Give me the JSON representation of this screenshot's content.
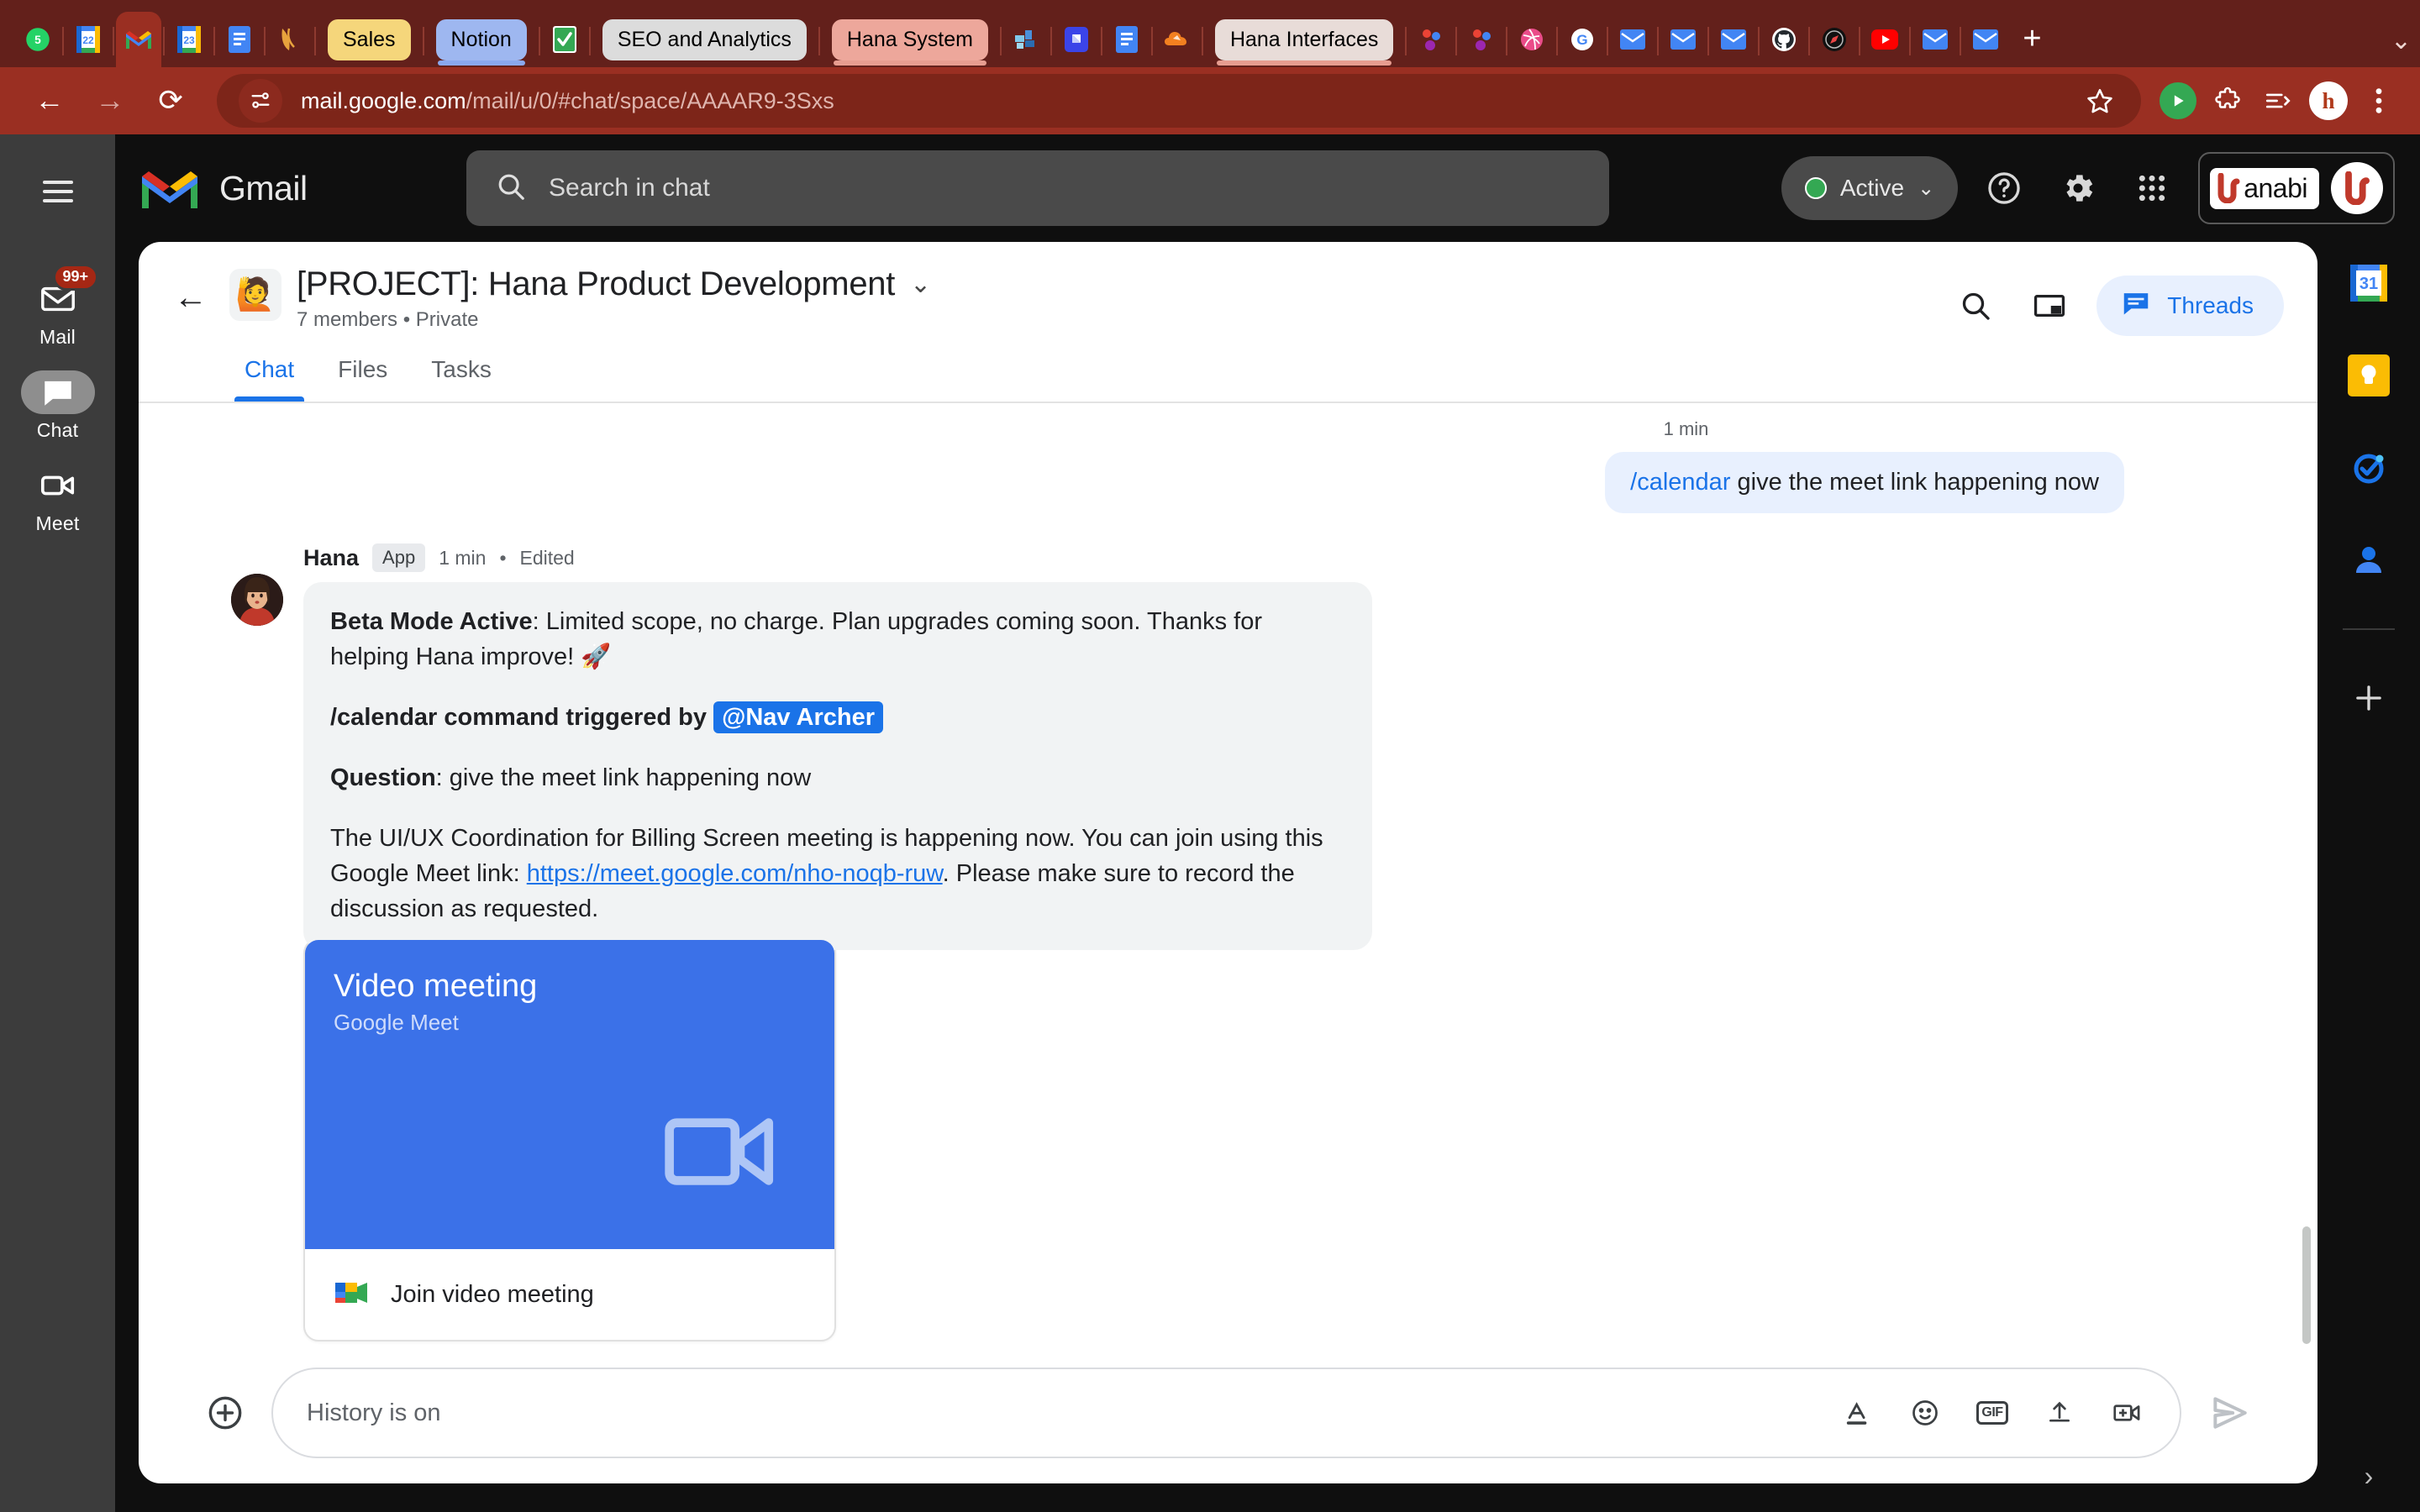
{
  "browser": {
    "tabs": [
      {
        "name": "whatsapp-tab",
        "label": "",
        "icon": "whatsapp-icon",
        "color": "#25D366",
        "text": "5",
        "style": "icon"
      },
      {
        "name": "calendar-22-tab",
        "label": "",
        "icon": "calendar-icon",
        "color": "#ffffff",
        "text": "22",
        "style": "icon"
      },
      {
        "name": "gmail-tab",
        "label": "",
        "icon": "gmail-icon",
        "color": "#ffffff",
        "text": "M",
        "style": "icon",
        "active": true
      },
      {
        "name": "calendar-23-tab",
        "label": "",
        "icon": "calendar-icon",
        "color": "#ffffff",
        "text": "23",
        "style": "icon"
      },
      {
        "name": "docs-tab",
        "label": "",
        "icon": "docs-icon",
        "color": "#4285f4",
        "text": "",
        "style": "icon"
      },
      {
        "name": "figma-tab",
        "label": "",
        "icon": "feather-icon",
        "color": "#e8a33d",
        "text": "",
        "style": "icon"
      },
      {
        "name": "sales-tab",
        "label": "Sales",
        "icon": "",
        "color": "#f5d67b",
        "text": "",
        "style": "pill"
      },
      {
        "name": "notion-tab",
        "label": "Notion",
        "icon": "",
        "color": "#9eb7f0",
        "text": "",
        "style": "pill",
        "underline": "#8aa8ee"
      },
      {
        "name": "tasks-tab",
        "label": "",
        "icon": "checkmark-icon",
        "color": "#34a853",
        "text": "✓",
        "style": "icon"
      },
      {
        "name": "seo-tab",
        "label": "SEO and Analytics",
        "icon": "",
        "color": "#dcdcdc",
        "text": "",
        "style": "pill"
      },
      {
        "name": "hana-system-tab",
        "label": "Hana System",
        "icon": "",
        "color": "#eda79b",
        "text": "",
        "style": "pill",
        "underline": "#e79d90"
      },
      {
        "name": "slack-tab",
        "label": "",
        "icon": "slack-icon",
        "color": "#4a90d9",
        "text": "",
        "style": "icon"
      },
      {
        "name": "zapier-tab",
        "label": "",
        "icon": "zapier-icon",
        "color": "#3b44e8",
        "text": "",
        "style": "icon"
      },
      {
        "name": "docs2-tab",
        "label": "",
        "icon": "docs-icon",
        "color": "#4285f4",
        "text": "",
        "style": "icon"
      },
      {
        "name": "cloud-tab",
        "label": "",
        "icon": "cloudflare-icon",
        "color": "#f38020",
        "text": "",
        "style": "icon"
      },
      {
        "name": "hana-interfaces-tab",
        "label": "Hana Interfaces",
        "icon": "",
        "color": "#e8dcd8",
        "text": "",
        "style": "pill",
        "underline": "#e79d90"
      },
      {
        "name": "people-tab",
        "label": "",
        "icon": "people-icon",
        "color": "#4285f4",
        "text": "",
        "style": "icon"
      },
      {
        "name": "people2-tab",
        "label": "",
        "icon": "people-icon",
        "color": "#db4437",
        "text": "",
        "style": "icon"
      },
      {
        "name": "dribbble-tab",
        "label": "",
        "icon": "dribbble-icon",
        "color": "#ea4c89",
        "text": "",
        "style": "icon"
      },
      {
        "name": "google-tab",
        "label": "",
        "icon": "google-icon",
        "color": "#4285f4",
        "text": "G",
        "style": "icon"
      },
      {
        "name": "mail2-tab",
        "label": "",
        "icon": "mail-icon",
        "color": "#4285f4",
        "text": "",
        "style": "icon"
      },
      {
        "name": "mail3-tab",
        "label": "",
        "icon": "mail-icon",
        "color": "#4285f4",
        "text": "",
        "style": "icon"
      },
      {
        "name": "mail4-tab",
        "label": "",
        "icon": "mail-icon",
        "color": "#4285f4",
        "text": "",
        "style": "icon"
      },
      {
        "name": "github-tab",
        "label": "",
        "icon": "github-icon",
        "color": "#ffffff",
        "text": "",
        "style": "icon"
      },
      {
        "name": "safari-tab",
        "label": "",
        "icon": "compass-icon",
        "color": "#111111",
        "text": "",
        "style": "icon"
      },
      {
        "name": "youtube-tab",
        "label": "",
        "icon": "youtube-icon",
        "color": "#ff0000",
        "text": "",
        "style": "icon"
      },
      {
        "name": "mail5-tab",
        "label": "",
        "icon": "mail-icon",
        "color": "#4285f4",
        "text": "",
        "style": "icon"
      },
      {
        "name": "mail6-tab",
        "label": "",
        "icon": "mail-icon",
        "color": "#4285f4",
        "text": "",
        "style": "icon"
      }
    ],
    "new_tab_label": "+",
    "tab_list_chevron": "⌄",
    "url": {
      "domain": "mail.google.com",
      "path": "/mail/u/0/#chat/space/AAAAR9-3Sxs"
    },
    "nav": {
      "back": "←",
      "forward": "→",
      "reload": "⟳",
      "site_info_icon": "tune-icon",
      "bookmark_icon": "star-icon",
      "profile_icon": "profile-icon",
      "extensions_icon": "puzzle-icon",
      "split_icon": "split-icon",
      "menu_icon": "kebab-menu-icon"
    }
  },
  "gmail": {
    "brand": "Gmail",
    "search": {
      "placeholder": "Search in chat",
      "icon": "search-icon"
    },
    "status": {
      "label": "Active",
      "chevron": "⌄",
      "color": "#34a853"
    },
    "header_icons": {
      "help": "help-icon",
      "settings": "gear-icon",
      "apps": "apps-grid-icon"
    },
    "account": {
      "workspace_name": "anabi",
      "avatar_letter": "h"
    }
  },
  "left_rail": {
    "menu_icon": "hamburger-icon",
    "items": [
      {
        "label": "Mail",
        "icon": "mail-icon",
        "badge": "99+",
        "selected": false
      },
      {
        "label": "Chat",
        "icon": "chat-bubble-icon",
        "badge": "",
        "selected": true
      },
      {
        "label": "Meet",
        "icon": "video-camera-icon",
        "badge": "",
        "selected": false
      }
    ]
  },
  "space": {
    "back_icon": "back-arrow-icon",
    "avatar_emoji": "🙋",
    "title": "[PROJECT]: Hana Product Development",
    "title_chevron": "⌄",
    "subtitle": "7 members  •  Private",
    "actions": {
      "search_icon": "search-icon",
      "pip_icon": "picture-in-picture-icon",
      "threads_label": "Threads",
      "threads_icon": "threads-chat-icon"
    },
    "tabs": [
      {
        "label": "Chat",
        "selected": true
      },
      {
        "label": "Files",
        "selected": false
      },
      {
        "label": "Tasks",
        "selected": false
      }
    ]
  },
  "conversation": {
    "top_timestamp": "1 min",
    "own_message": {
      "command": "/calendar",
      "text": " give the meet link happening now"
    },
    "bot_message": {
      "sender": "Hana",
      "app_tag": "App",
      "time": "1 min",
      "separator": "•",
      "edited": "Edited",
      "paragraphs": [
        {
          "bold_prefix": "Beta Mode Active",
          "text": ": Limited scope, no charge. Plan upgrades coming soon. Thanks for helping Hana improve! 🚀"
        },
        {
          "bold_prefix": "/calendar command triggered by",
          "mention": "@Nav Archer"
        },
        {
          "bold_prefix": "Question",
          "text": ": give the meet link happening now"
        },
        {
          "text_before": "The UI/UX Coordination for Billing Screen meeting is happening now. You can join using this Google Meet link: ",
          "link": "https://meet.google.com/nho-noqb-ruw",
          "text_after": ". Please make sure to record the discussion as requested."
        }
      ]
    },
    "meet_card": {
      "title": "Video meeting",
      "subtitle": "Google Meet",
      "camera_icon": "video-camera-icon",
      "join_label": "Join video meeting",
      "join_icon": "google-meet-icon"
    }
  },
  "composer": {
    "plus_icon": "add-circle-icon",
    "placeholder": "History is on",
    "icons": [
      {
        "name": "format-text-icon",
        "glyph": "A"
      },
      {
        "name": "emoji-icon",
        "glyph": "☺"
      },
      {
        "name": "gif-icon",
        "glyph": "GIF"
      },
      {
        "name": "upload-icon",
        "glyph": "⬆"
      },
      {
        "name": "video-meeting-icon",
        "glyph": "▣"
      }
    ],
    "send_icon": "send-icon"
  },
  "right_rail": {
    "items": [
      {
        "name": "calendar-side-icon",
        "label": "31"
      },
      {
        "name": "keep-side-icon",
        "label": ""
      },
      {
        "name": "tasks-side-icon",
        "label": ""
      },
      {
        "name": "contacts-side-icon",
        "label": ""
      }
    ],
    "add_label": "+",
    "expand_label": "›"
  }
}
